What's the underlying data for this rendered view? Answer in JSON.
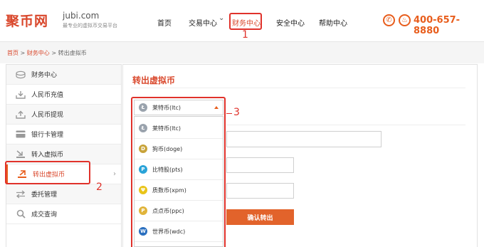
{
  "header": {
    "logo_text": "聚币网",
    "logo_domain": "jubi.com",
    "logo_slogan": "最专业的虚拟币交易平台",
    "nav": [
      {
        "label": "首页"
      },
      {
        "label": "交易中心"
      },
      {
        "label": "财务中心"
      },
      {
        "label": "安全中心"
      },
      {
        "label": "帮助中心"
      }
    ],
    "phone": "400-657-8880",
    "phone_icon": "phone-icon",
    "support_icon": "bell-icon"
  },
  "annotations": {
    "n1": "1",
    "n2": "2",
    "n3": "3"
  },
  "breadcrumb": {
    "home": "首页",
    "sep": ">",
    "finance": "财务中心",
    "current": "转出虚拟币"
  },
  "sidebar": {
    "items": [
      {
        "label": "财务中心",
        "icon": "coins-icon"
      },
      {
        "label": "人民币充值",
        "icon": "download-tray-icon"
      },
      {
        "label": "人民币提现",
        "icon": "upload-tray-icon"
      },
      {
        "label": "银行卡管理",
        "icon": "card-icon"
      },
      {
        "label": "转入虚拟币",
        "icon": "import-icon"
      },
      {
        "label": "转出虚拟币",
        "icon": "export-icon"
      },
      {
        "label": "委托管理",
        "icon": "swap-icon"
      },
      {
        "label": "成交查询",
        "icon": "search-icon"
      }
    ],
    "chevron": "›"
  },
  "main": {
    "title": "转出虚拟币",
    "select_value": "莱特币(ltc)",
    "options": [
      {
        "label": "莱特币(ltc)",
        "color": "#9aa3ad"
      },
      {
        "label": "狗币(doge)",
        "color": "#c8a33a"
      },
      {
        "label": "比特股(pts)",
        "color": "#2aa3d8"
      },
      {
        "label": "质数币(xpm)",
        "color": "#e9c419"
      },
      {
        "label": "点点币(ppc)",
        "color": "#e0b43b"
      },
      {
        "label": "世界币(wdc)",
        "color": "#2a6fbf"
      }
    ],
    "confirm_label": "确认转出"
  },
  "colors": {
    "brand": "#d9472b",
    "accent": "#e85d1c",
    "highlight": "#e0322b"
  }
}
